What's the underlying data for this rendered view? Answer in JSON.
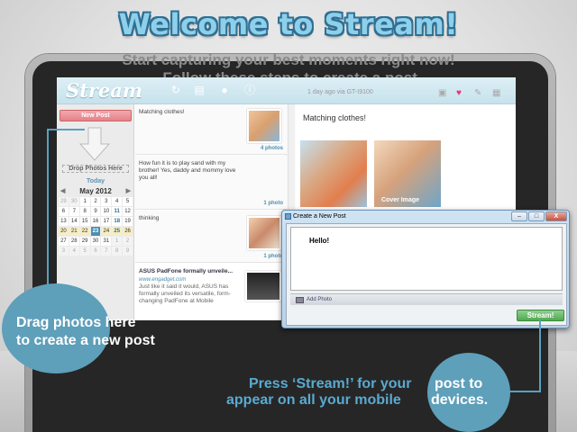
{
  "headline": "Welcome to Stream!",
  "subtitle_line1": "Start capturing your best moments right now!",
  "subtitle_line2": "Follow these steps to create a post.",
  "app": {
    "logo": "Stream",
    "meta": "1 day ago via GT-I9100",
    "new_post": "New Post",
    "drop_photos": "Drop Photos Here",
    "today": "Today",
    "calendar": {
      "month": "May",
      "year": "2012",
      "weekdays": [
        "",
        "",
        "",
        "",
        "",
        "",
        ""
      ],
      "weeks": [
        [
          "29",
          "30",
          "1",
          "2",
          "3",
          "4",
          "5"
        ],
        [
          "6",
          "7",
          "8",
          "9",
          "10",
          "11",
          "12"
        ],
        [
          "13",
          "14",
          "15",
          "16",
          "17",
          "18",
          "19"
        ],
        [
          "20",
          "21",
          "22",
          "23",
          "24",
          "25",
          "26"
        ],
        [
          "27",
          "28",
          "29",
          "30",
          "31",
          "1",
          "2"
        ],
        [
          "3",
          "4",
          "5",
          "6",
          "7",
          "8",
          "9"
        ]
      ]
    },
    "posts": [
      {
        "text": "Matching clothes!",
        "count": "4 photos"
      },
      {
        "text": "How fun it is to play sand with my brother! Yes, daddy and mommy love you all!",
        "count": "1 photo"
      },
      {
        "text": "thinking",
        "count": "1 photo"
      },
      {
        "title": "ASUS PadFone formally unveile...",
        "link": "www.engadget.com",
        "text": "Just like it said it would, ASUS has formally unveiled its versatile, form-changing PadFone at Mobile"
      }
    ],
    "detail_title": "Matching clothes!",
    "cover_label": "Cover Image"
  },
  "dialog": {
    "title": "Create a New Post",
    "body_text": "Hello!",
    "add_photo": "Add Photo",
    "stream_button": "Stream!",
    "minimize": "–",
    "maximize": "□",
    "close": "X"
  },
  "callout_left": {
    "line1": "Drag photos here",
    "line2": "to create a new post"
  },
  "callout_right": {
    "line1a": "Press ‘Stream!’ for your",
    "line1b": "post to",
    "line2a": "appear on all your mobile",
    "line2b": "devices."
  },
  "colors": {
    "accent": "#5e9fba",
    "title_fill": "#8ed0ea",
    "new_post": "#e3828a",
    "stream_btn": "#4fa94f"
  }
}
